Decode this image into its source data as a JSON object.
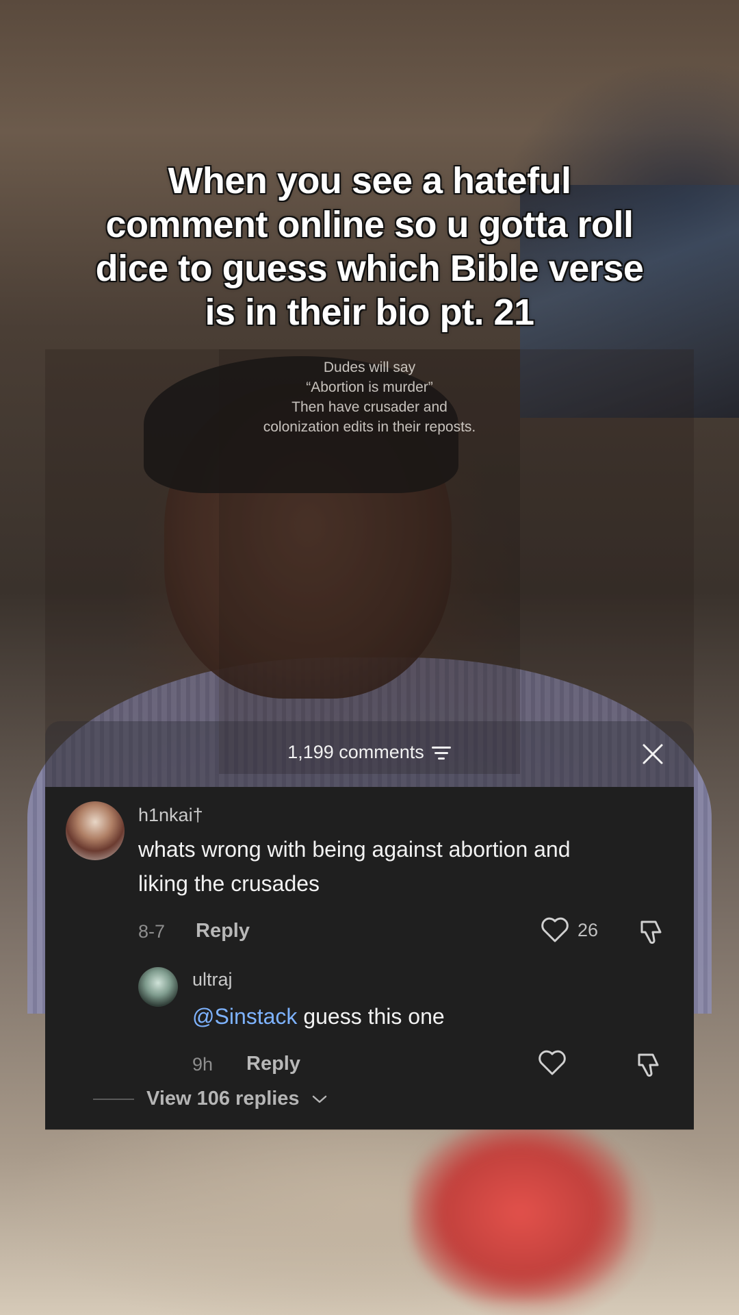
{
  "caption": {
    "lines": [
      "When you see a hateful",
      "comment online so u gotta roll",
      "dice to guess which Bible verse",
      "is in their bio pt. 21"
    ]
  },
  "quote": {
    "lines": [
      "Dudes will say",
      "“Abortion is murder”",
      "Then have crusader and",
      "colonization edits in their reposts."
    ]
  },
  "comments_sheet": {
    "count_label": "1,199 comments",
    "sort_icon": "sort-filter-icon",
    "close_icon": "close-icon",
    "comment": {
      "username": "h1nkai†",
      "text_lines": [
        "whats wrong with being against abortion and",
        "liking the crusades"
      ],
      "date": "8-7",
      "reply_label": "Reply",
      "likes": "26"
    },
    "reply": {
      "username": "ultraj",
      "mention": "@Sinstack",
      "text": " guess this one",
      "time": "9h",
      "reply_label": "Reply"
    },
    "view_replies_label": "View 106 replies"
  },
  "colors": {
    "sheet_bg": "#1f1f1f",
    "mention": "#7eb3ff",
    "caption_text": "#ffffff"
  }
}
